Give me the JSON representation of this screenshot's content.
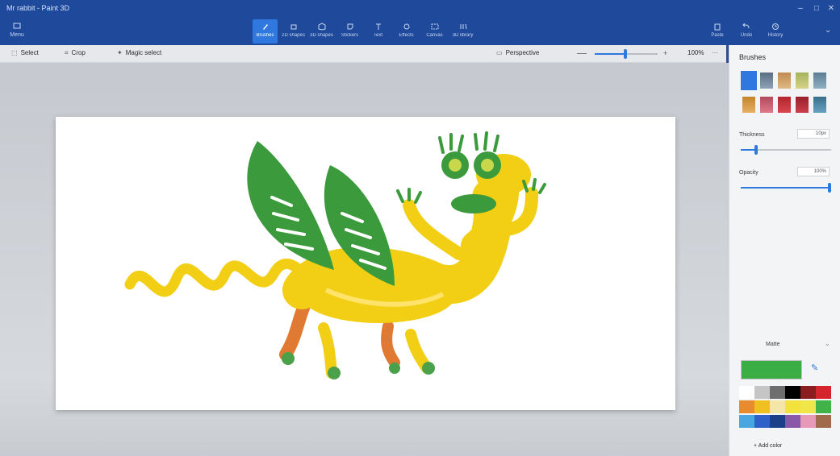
{
  "window": {
    "title": "Mr rabbit - Paint 3D",
    "controls": [
      "–",
      "□",
      "✕"
    ]
  },
  "ribbon": {
    "menu": {
      "label": "Menu",
      "icon": "folder-icon"
    },
    "tools": [
      {
        "label": "Brushes",
        "icon": "brush-icon",
        "active": true
      },
      {
        "label": "2D shapes",
        "icon": "shapes2d-icon",
        "active": false
      },
      {
        "label": "3D shapes",
        "icon": "shapes3d-icon",
        "active": false
      },
      {
        "label": "Stickers",
        "icon": "sticker-icon",
        "active": false
      },
      {
        "label": "Text",
        "icon": "text-icon",
        "active": false
      },
      {
        "label": "Effects",
        "icon": "effects-icon",
        "active": false
      },
      {
        "label": "Canvas",
        "icon": "canvas-icon",
        "active": false
      },
      {
        "label": "3D library",
        "icon": "library-icon",
        "active": false
      }
    ],
    "right": [
      {
        "label": "Paste",
        "icon": "paste-icon"
      },
      {
        "label": "Undo",
        "icon": "undo-icon"
      },
      {
        "label": "History",
        "icon": "history-icon"
      }
    ],
    "more": "⌄"
  },
  "toolbar2": {
    "select": "Select",
    "crop": "Crop",
    "magic_select": "Magic select",
    "view": "Perspective",
    "zoom": "100%"
  },
  "sidepanel": {
    "title": "Brushes",
    "thickness_label": "Thickness",
    "thickness_value": "10px",
    "thickness_level": 0.15,
    "opacity_label": "Opacity",
    "opacity_value": "100%",
    "opacity_level": 1.0,
    "color_header": "Matte",
    "eyedropper_icon": "eyedropper-icon",
    "add_color": "+ Add color",
    "palette": [
      "#ffffff",
      "#c5c5c5",
      "#6e6e6e",
      "#000000",
      "#8a1d1d",
      "#d6242c",
      "#e88a2e",
      "#f0c020",
      "#f4e6a8",
      "#f3e23b",
      "#f0e64a",
      "#3fb24a",
      "#48a7e0",
      "#2f62c8",
      "#1c3f8a",
      "#8a58a9",
      "#e69ab8",
      "#a06b4a"
    ],
    "current_color": "#3aad45"
  }
}
